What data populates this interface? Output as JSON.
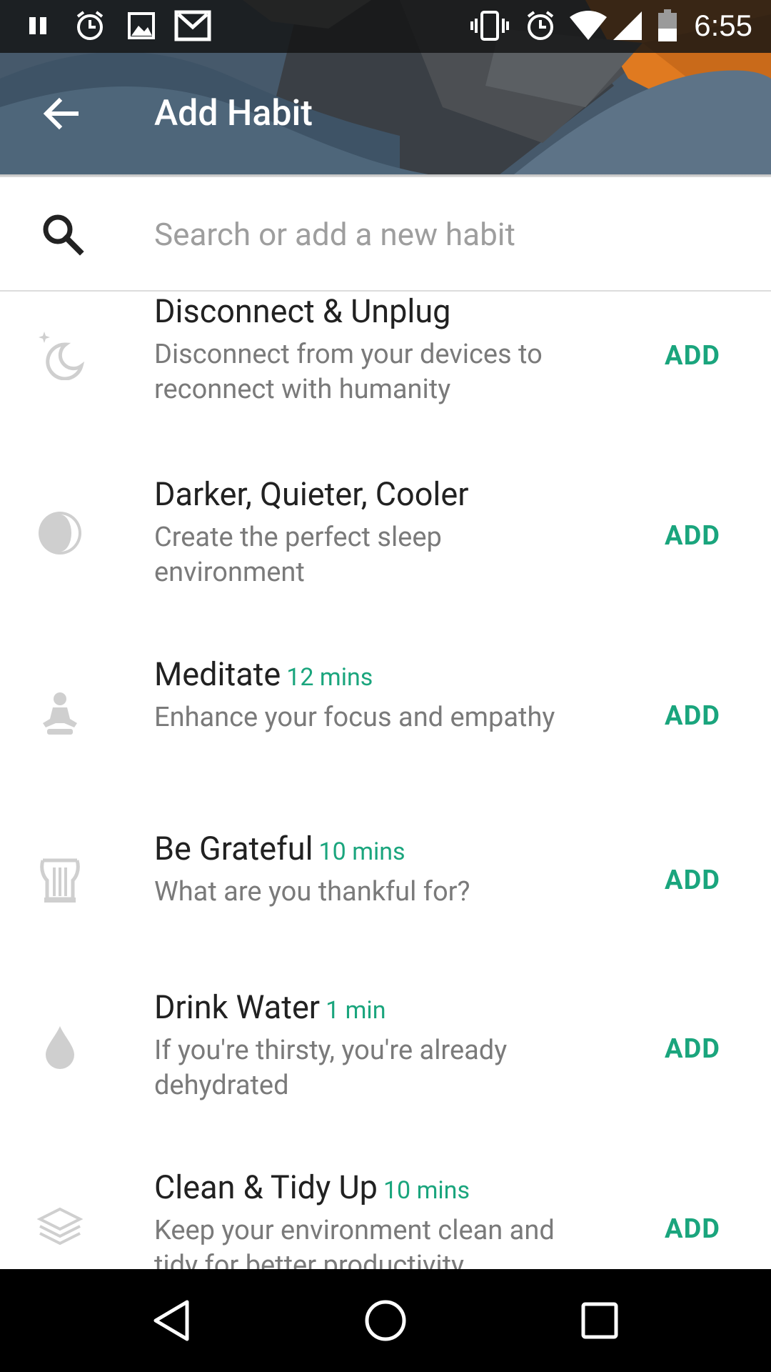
{
  "status_bar": {
    "time": "6:55",
    "icons_left": [
      "pause-icon",
      "alarm-icon",
      "image-icon",
      "gmail-icon"
    ],
    "icons_right": [
      "vibrate-icon",
      "alarm-icon",
      "wifi-icon",
      "signal-icon",
      "battery-icon"
    ]
  },
  "toolbar": {
    "title": "Add Habit",
    "back_icon": "arrow-back-icon"
  },
  "search": {
    "placeholder": "Search or add a new habit",
    "value": ""
  },
  "habits": [
    {
      "title": "Disconnect & Unplug",
      "duration": "",
      "description": "Disconnect from your devices to reconnect with humanity",
      "icon": "moon-star-icon",
      "action": "ADD"
    },
    {
      "title": "Darker, Quieter, Cooler",
      "duration": "",
      "description": "Create the perfect sleep environment",
      "icon": "half-circle-icon",
      "action": "ADD"
    },
    {
      "title": "Meditate",
      "duration": "12 mins",
      "description": "Enhance your focus and empathy",
      "icon": "meditation-icon",
      "action": "ADD"
    },
    {
      "title": "Be Grateful",
      "duration": "10 mins",
      "description": "What are you thankful for?",
      "icon": "lyre-icon",
      "action": "ADD"
    },
    {
      "title": "Drink Water",
      "duration": "1 min",
      "description": "If you're thirsty, you're already dehydrated",
      "icon": "water-drop-icon",
      "action": "ADD"
    },
    {
      "title": "Clean & Tidy Up",
      "duration": "10 mins",
      "description": "Keep your environment clean and tidy for better productivity",
      "icon": "stack-icon",
      "action": "ADD"
    }
  ],
  "colors": {
    "accent": "#1aa57d",
    "header": "#4a5f73",
    "orange_accent": "#e07a20",
    "icon_gray": "#cfcfcf"
  },
  "nav_bar": [
    "back-triangle-icon",
    "home-circle-icon",
    "recents-square-icon"
  ]
}
